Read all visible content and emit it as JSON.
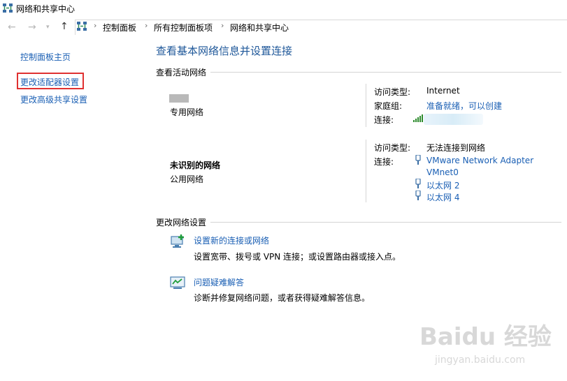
{
  "window": {
    "title": "网络和共享中心"
  },
  "address": {
    "crumbs": [
      "控制面板",
      "所有控制面板项",
      "网络和共享中心"
    ]
  },
  "sidebar": {
    "items": [
      {
        "label": "控制面板主页"
      },
      {
        "label": "更改适配器设置"
      },
      {
        "label": "更改高级共享设置"
      }
    ]
  },
  "main": {
    "heading": "查看基本网络信息并设置连接",
    "active_section": "查看活动网络",
    "networks": [
      {
        "name": "",
        "type": "专用网络",
        "access_label": "访问类型:",
        "access_value": "Internet",
        "homegroup_label": "家庭组:",
        "homegroup_value": "准备就绪，可以创建",
        "connection_label": "连接:"
      },
      {
        "name": "未识别的网络",
        "type": "公用网络",
        "access_label": "访问类型:",
        "access_value": "无法连接到网络",
        "connection_label": "连接:",
        "connections": [
          "VMware Network Adapter",
          "VMnet0",
          "以太网 2",
          "以太网 4"
        ]
      }
    ],
    "change_section": "更改网络设置",
    "tasks": [
      {
        "title": "设置新的连接或网络",
        "desc": "设置宽带、拨号或 VPN 连接；或设置路由器或接入点。"
      },
      {
        "title": "问题疑难解答",
        "desc": "诊断并修复网络问题，或者获得疑难解答信息。"
      }
    ]
  },
  "watermark": {
    "text": "Baidu 经验",
    "sub": "jingyan.baidu.com"
  },
  "colors": {
    "link": "#1a5fb4",
    "heading": "#1e5799",
    "highlight": "#e03131"
  }
}
